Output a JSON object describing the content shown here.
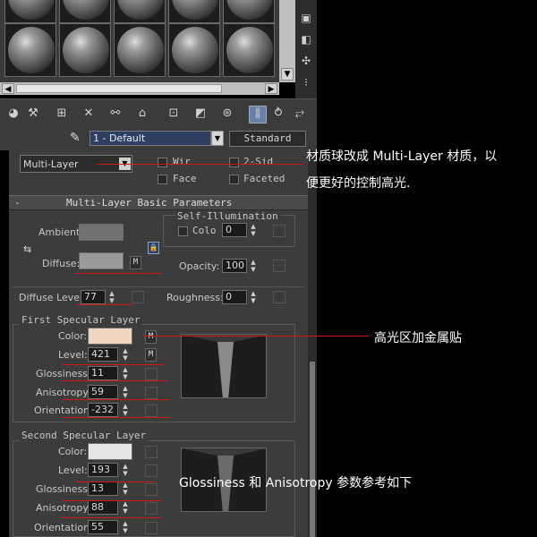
{
  "toolbar": {
    "material_name": "1 - Default",
    "material_type": "Standard"
  },
  "shader": {
    "selected": "Multi-Layer",
    "options": {
      "wire": "Wir",
      "two_sided": "2-Sid",
      "face": "Face",
      "faceted": "Faceted"
    }
  },
  "rollout": {
    "title": "Multi-Layer Basic Parameters",
    "minus": "-",
    "ambient_label": "Ambient:",
    "diffuse_label": "Diffuse:",
    "diffuse_map": "M",
    "self_illum": {
      "title": "Self-Illumination",
      "color_label": "Colo",
      "value": "0"
    },
    "opacity": {
      "label": "Opacity:",
      "value": "100"
    },
    "diffuse_level": {
      "label": "Diffuse Level:",
      "value": "77"
    },
    "roughness": {
      "label": "Roughness:",
      "value": "0"
    }
  },
  "first_specular": {
    "title": "First Specular Layer",
    "color_label": "Color:",
    "color_map": "M",
    "level_label": "Level:",
    "level": "421",
    "level_map": "M",
    "glossiness_label": "Glossiness:",
    "glossiness": "11",
    "anisotropy_label": "Anisotropy:",
    "anisotropy": "59",
    "orientation_label": "Orientation:",
    "orientation": "-232"
  },
  "second_specular": {
    "title": "Second Specular Layer",
    "color_label": "Color:",
    "level_label": "Level:",
    "level": "193",
    "glossiness_label": "Glossiness:",
    "glossiness": "13",
    "anisotropy_label": "Anisotropy:",
    "anisotropy": "88",
    "orientation_label": "Orientation:",
    "orientation": "55"
  },
  "annotations": {
    "shader_note_line1": "材质球改成 Multi-Layer 材质，以",
    "shader_note_line2": "便更好的控制高光.",
    "specular_note": "高光区加金属贴",
    "params_note": "Glossiness 和 Anisotropy 参数参考如下"
  },
  "colors": {
    "panel_bg": "#3c3c3c",
    "ambient_color": "#727272",
    "diffuse_color": "#9a9a9a",
    "specular1_color": "#f0d6c0",
    "specular2_color": "#e6e6e6",
    "field_text": "#d8d8d8",
    "annotation_red": "#d01818"
  },
  "icons": [
    "get-material-icon",
    "pick-material-icon",
    "put-to-library-icon",
    "delete-icon",
    "make-unique-icon",
    "put-to-scene-icon",
    "material-effects-channel-icon",
    "show-map-icon",
    "show-end-result-icon",
    "go-to-parent-icon",
    "go-forward-icon",
    "sample-type-icon",
    "backlight-icon",
    "background-icon",
    "video-check-icon",
    "make-preview-icon",
    "options-icon",
    "eyedropper-icon",
    "dropdown-arrow-icon",
    "lock-icon",
    "swap-icon"
  ]
}
